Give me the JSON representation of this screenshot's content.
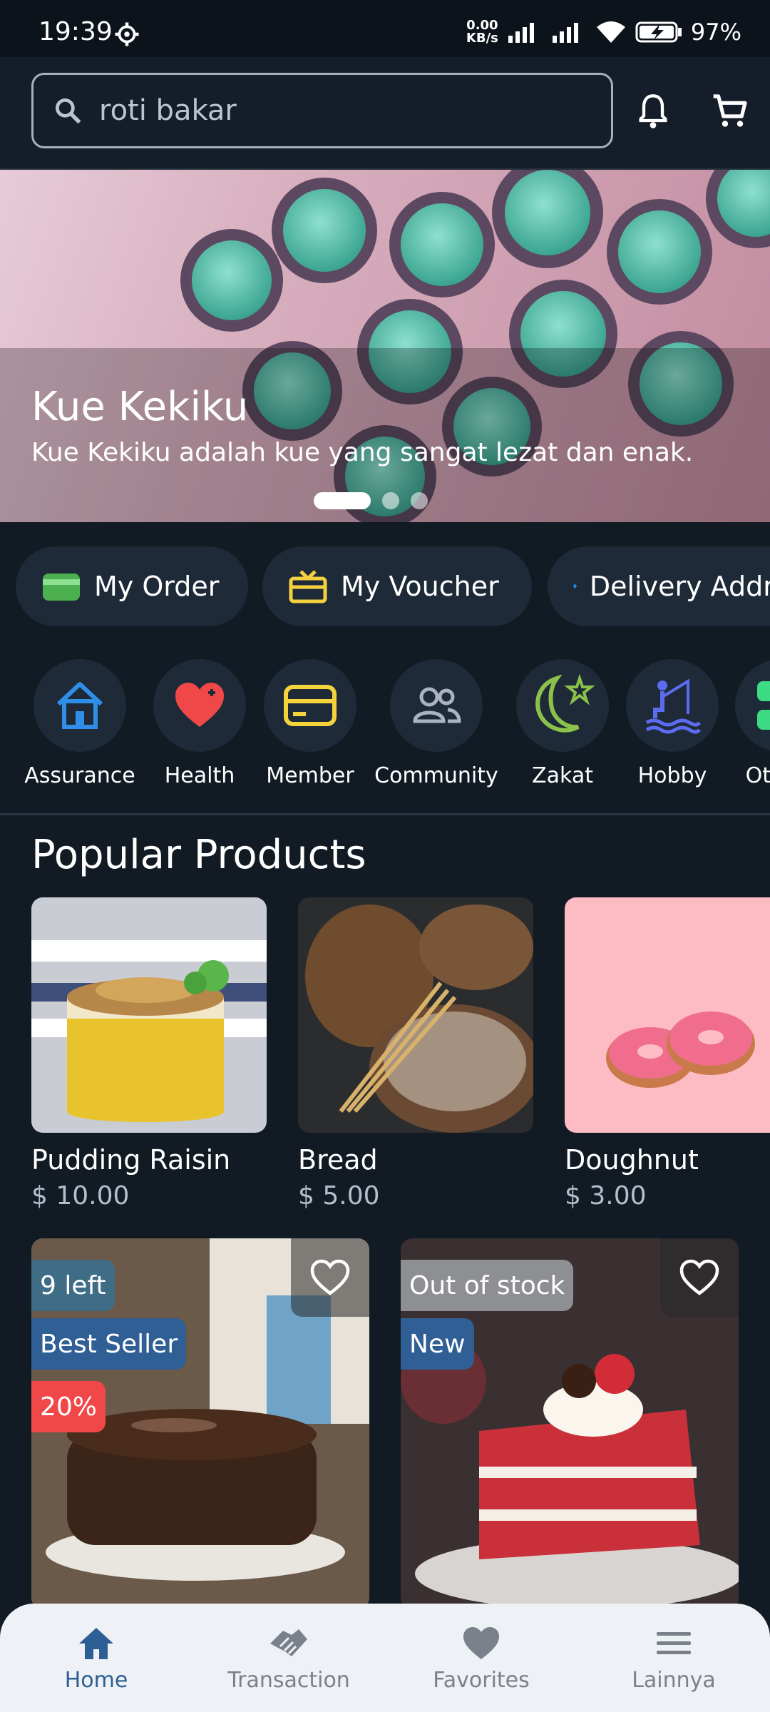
{
  "status_bar": {
    "time": "19:39",
    "net_speed_value": "0.00",
    "net_speed_unit": "KB/s",
    "battery": "97%"
  },
  "header": {
    "search_value": "roti bakar",
    "icons": [
      "search-icon",
      "bell-icon",
      "cart-icon"
    ]
  },
  "hero": {
    "title": "Kue Kekiku",
    "description": "Kue Kekiku adalah kue yang sangat lezat dan enak.",
    "slides_total": 3,
    "active_slide": 1
  },
  "quick_actions": [
    {
      "label": "My Order",
      "icon": "wallet-icon",
      "color": "#4caf50"
    },
    {
      "label": "My Voucher",
      "icon": "gift-icon",
      "color": "#f4d03f"
    },
    {
      "label": "Delivery Address",
      "icon": "location-pin-icon",
      "color": "#2196f3"
    }
  ],
  "categories": [
    {
      "label": "Assurance",
      "icon": "house-icon",
      "color": "#2f8fe8"
    },
    {
      "label": "Health",
      "icon": "heart-plus-icon",
      "color": "#f04848"
    },
    {
      "label": "Member",
      "icon": "card-icon",
      "color": "#f5d33b"
    },
    {
      "label": "Community",
      "icon": "people-icon",
      "color": "#aab4c0"
    },
    {
      "label": "Zakat",
      "icon": "moon-star-icon",
      "color": "#8bc34a"
    },
    {
      "label": "Hobby",
      "icon": "fishing-icon",
      "color": "#5c6bf0"
    },
    {
      "label": "Others",
      "icon": "others-icon",
      "color": "#3ddc84"
    }
  ],
  "popular": {
    "title": "Popular Products",
    "products": [
      {
        "name": "Pudding Raisin",
        "price": "$ 10.00"
      },
      {
        "name": "Bread",
        "price": "$ 5.00"
      },
      {
        "name": "Doughnut",
        "price": "$ 3.00"
      }
    ]
  },
  "featured": [
    {
      "badges": [
        "9 left",
        "Best Seller",
        "20%"
      ],
      "badge_colors": [
        "#3f6d86",
        "#2f5f94",
        "#f04848"
      ]
    },
    {
      "badges": [
        "Out of stock",
        "New"
      ],
      "badge_colors": [
        "#8d8f92",
        "#2f5f94"
      ]
    }
  ],
  "bottom_nav": [
    {
      "label": "Home",
      "icon": "home-icon",
      "active": true
    },
    {
      "label": "Transaction",
      "icon": "handshake-icon",
      "active": false
    },
    {
      "label": "Favorites",
      "icon": "heart-icon",
      "active": false
    },
    {
      "label": "Lainnya",
      "icon": "menu-icon",
      "active": false
    }
  ],
  "colors": {
    "background": "#121a24",
    "surface": "#1e2a38",
    "accent": "#2e5f94",
    "nav_bg": "#eef1f6"
  }
}
